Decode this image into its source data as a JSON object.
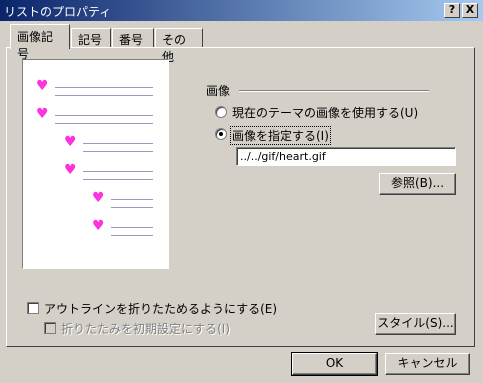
{
  "window": {
    "title": "リストのプロパティ",
    "help_button": "?",
    "close_button": "X"
  },
  "tabs": [
    {
      "label": "画像記号",
      "active": true
    },
    {
      "label": "記号",
      "active": false
    },
    {
      "label": "番号",
      "active": false
    },
    {
      "label": "その他",
      "active": false
    }
  ],
  "preview": {
    "bullet_icon": "heart-icon",
    "bullet_color": "#ff33dd",
    "bullet_glyph": "♥"
  },
  "image_group": {
    "label": "画像",
    "option_theme": "現在のテーマの画像を使用する(U)",
    "option_specify": "画像を指定する(I)",
    "selected": "specify",
    "path_value": "../../gif/heart.gif",
    "browse_label": "参照(B)..."
  },
  "options": {
    "outline_label": "アウトラインを折りたためるようにする(E)",
    "outline_checked": false,
    "collapse_label": "折りたたみを初期設定にする(I)",
    "collapse_checked": false,
    "collapse_enabled": false,
    "style_label": "スタイル(S)..."
  },
  "footer": {
    "ok_label": "OK",
    "cancel_label": "キャンセル"
  }
}
